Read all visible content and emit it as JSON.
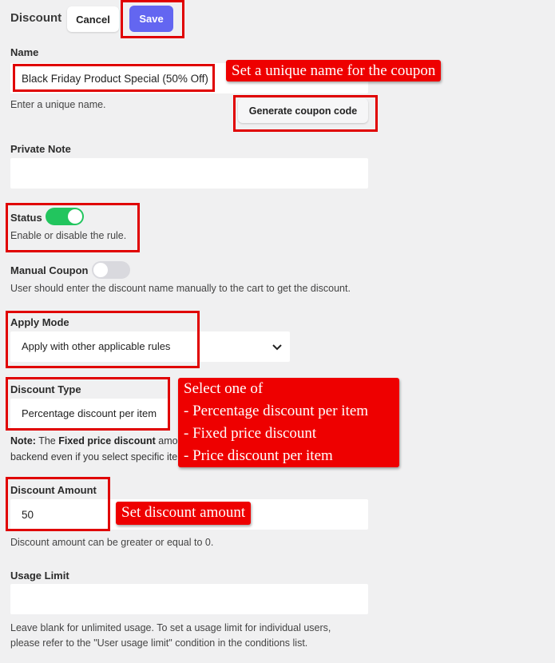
{
  "header": {
    "title": "Discount",
    "cancel_label": "Cancel",
    "save_label": "Save"
  },
  "name": {
    "label": "Name",
    "value": "Black Friday Product Special (50% Off)",
    "help": "Enter a unique name.",
    "generate_label": "Generate coupon code"
  },
  "private_note": {
    "label": "Private Note",
    "value": ""
  },
  "status": {
    "label": "Status",
    "enabled": true,
    "help": "Enable or disable the rule."
  },
  "manual_coupon": {
    "label": "Manual Coupon",
    "enabled": false,
    "help": "User should enter the discount name manually to the cart to get the discount."
  },
  "apply_mode": {
    "label": "Apply Mode",
    "value": "Apply with other applicable rules"
  },
  "discount_type": {
    "label": "Discount Type",
    "value": "Percentage discount per item",
    "note_prefix": "Note:",
    "note_mid": " The ",
    "note_bold": "Fixed price discount",
    "note_line1_rest": " amo",
    "note_line2": "backend even if you select specific ite"
  },
  "discount_amount": {
    "label": "Discount Amount",
    "value": "50",
    "help": "Discount amount can be greater or equal to 0."
  },
  "usage_limit": {
    "label": "Usage Limit",
    "value": "",
    "help_line1": "Leave blank for unlimited usage. To set a usage limit for individual users,",
    "help_line2": "please refer to the \"User usage limit\" condition in the conditions list."
  },
  "callouts": {
    "name": "Set a unique name for the coupon",
    "type": "Select one of\n- Percentage discount per item\n- Fixed price discount\n- Price discount per item",
    "amount": "Set discount amount"
  },
  "colors": {
    "accent": "#6366f1",
    "toggle_on": "#22c55e",
    "toggle_off": "#d9d9de",
    "annotation_red": "#ee0000"
  }
}
